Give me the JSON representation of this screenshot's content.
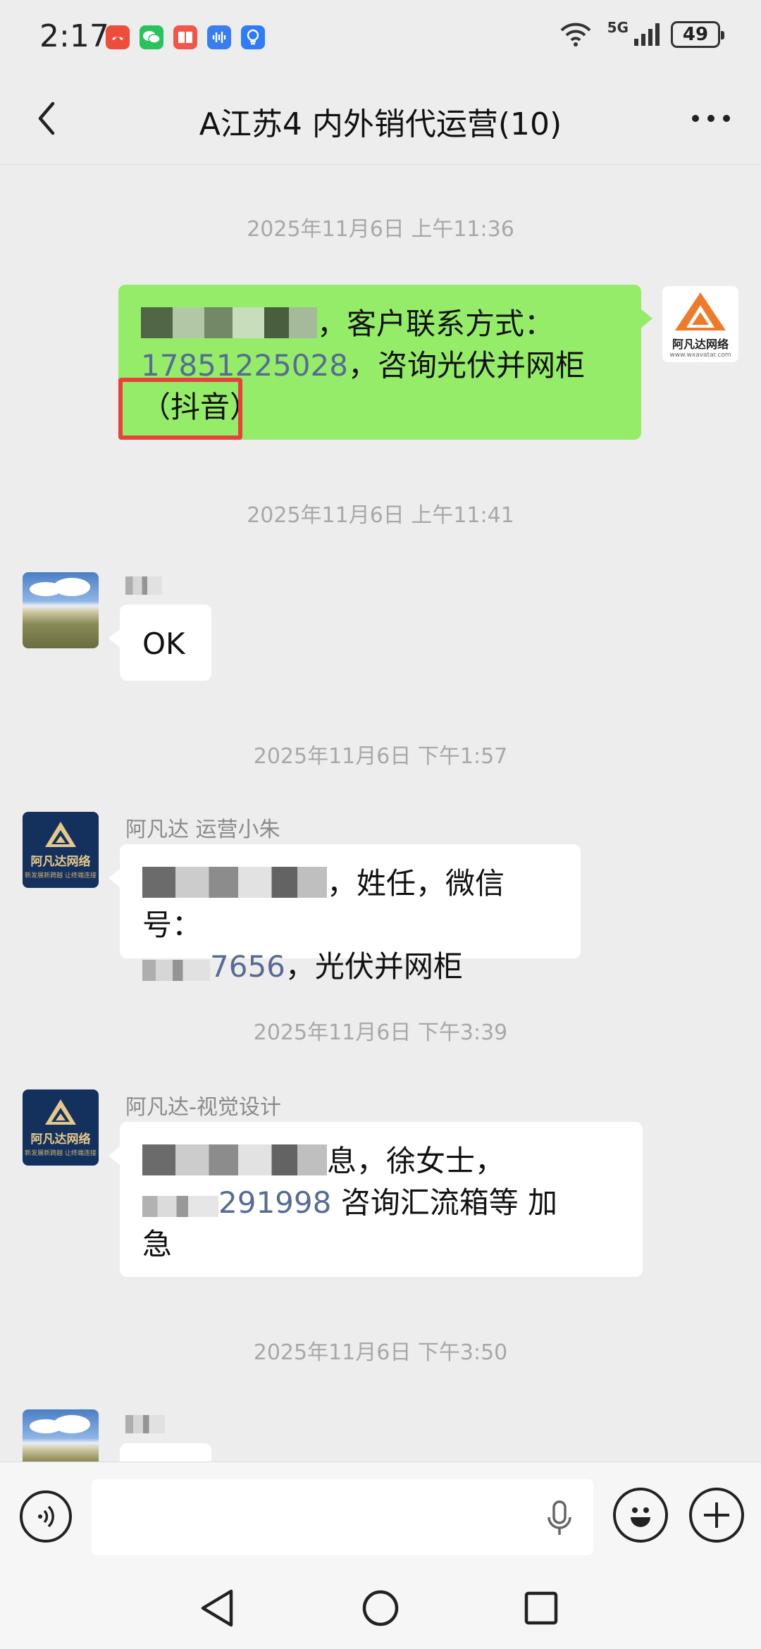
{
  "status_bar": {
    "time": "2:17",
    "network": "5G",
    "battery": "49",
    "notification_icons": [
      "missed-call-icon",
      "wechat-icon",
      "book-icon",
      "voice-recorder-icon",
      "lightbulb-icon"
    ]
  },
  "header": {
    "title": "A江苏4 内外销代运营(10)"
  },
  "messages": [
    {
      "type": "timestamp",
      "text": "2025年11月6日 上午11:36"
    },
    {
      "type": "message",
      "side": "right",
      "sender": "",
      "avatar": "brand-logo-white",
      "text_after_blur": "，客户联系方式：",
      "phone": "17851225028",
      "text_line2_after_phone": "，咨询光伏并网柜",
      "tag": "（抖音）"
    },
    {
      "type": "timestamp",
      "text": "2025年11月6日 上午11:41"
    },
    {
      "type": "message",
      "side": "left",
      "sender": "",
      "avatar": "landscape-photo",
      "text": "OK"
    },
    {
      "type": "timestamp",
      "text": "2025年11月6日 下午1:57"
    },
    {
      "type": "message",
      "side": "left",
      "sender": "阿凡达 运营小朱",
      "avatar": "brand-logo-navy",
      "text_line1": "，姓任，微信号：",
      "phone_tail": "7656",
      "text_line2": "，光伏并网柜"
    },
    {
      "type": "timestamp",
      "text": "2025年11月6日 下午3:39"
    },
    {
      "type": "message",
      "side": "left",
      "sender": "阿凡达-视觉设计",
      "avatar": "brand-logo-navy",
      "text_line1": "息，徐女士，",
      "phone_tail": "291998",
      "text_line2_rest": "  咨询汇流箱等 加",
      "text_line3": "急"
    },
    {
      "type": "timestamp",
      "text": "2025年11月6日 下午3:50"
    }
  ],
  "brand": {
    "name": "阿凡达网络",
    "sub": "新发展新跨越 让终端连接",
    "site": "www.wxavatar.com"
  },
  "input": {
    "placeholder": "",
    "value": ""
  },
  "colors": {
    "background": "#ededed",
    "sent_bubble": "#95ec69",
    "received_bubble": "#ffffff",
    "phone_link": "#576b95",
    "highlight": "#e8413a"
  }
}
